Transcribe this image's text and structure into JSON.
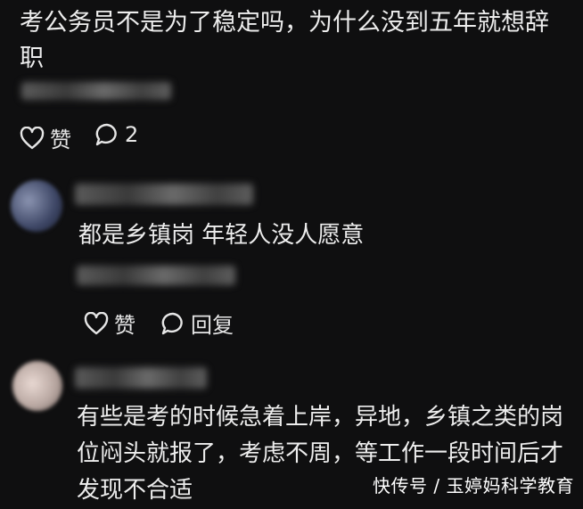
{
  "post": {
    "text": "考公务员不是为了稳定吗，为什么没到五年就想辞职",
    "like_label": "赞",
    "comment_count": "2"
  },
  "comments": [
    {
      "text": "都是乡镇岗 年轻人没人愿意",
      "like_label": "赞",
      "reply_label": "回复"
    },
    {
      "text": "有些是考的时候急着上岸，异地，乡镇之类的岗位闷头就报了，考虑不周，等工作一段时间后才发现不合适"
    }
  ],
  "watermark": "快传号 / 玉婷妈科学教育",
  "icons": [
    "heart-icon",
    "comment-bubble-icon"
  ]
}
